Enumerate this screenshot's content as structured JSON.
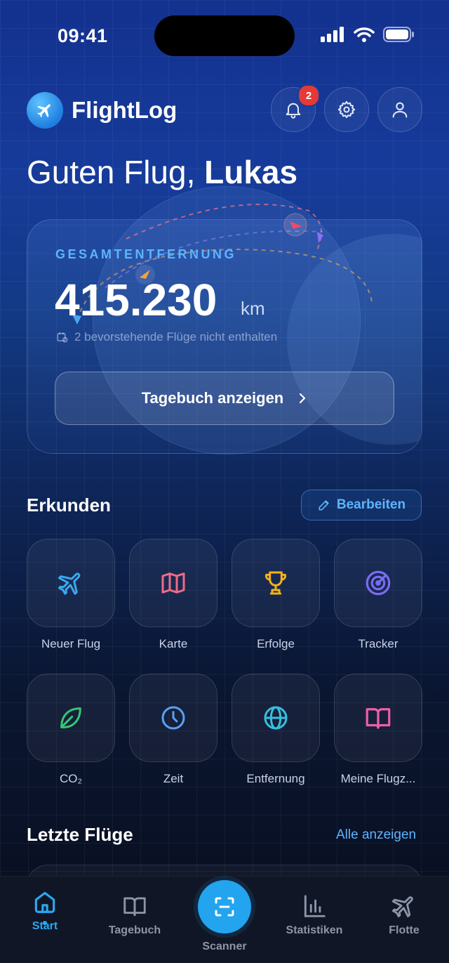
{
  "status_bar": {
    "time": "09:41"
  },
  "header": {
    "app_name": "FlightLog",
    "notifications_count": "2",
    "greeting_prefix": "Guten Flug,",
    "greeting_name": "Lukas"
  },
  "summary_card": {
    "label": "GESAMTENTFERNUNG",
    "value": "415.230",
    "unit": "km",
    "note": "2 bevorstehende Flüge nicht enthalten",
    "button_label": "Tagebuch anzeigen"
  },
  "explore": {
    "title": "Erkunden",
    "edit_label": "Bearbeiten",
    "tiles": [
      {
        "label": "Neuer Flug",
        "icon": "airplane-icon",
        "color": "#3aa8f0"
      },
      {
        "label": "Karte",
        "icon": "map-icon",
        "color": "#ef6b86"
      },
      {
        "label": "Erfolge",
        "icon": "trophy-icon",
        "color": "#f2b21c"
      },
      {
        "label": "Tracker",
        "icon": "radar-icon",
        "color": "#7b6cf5"
      },
      {
        "label": "CO₂",
        "icon": "leaf-icon",
        "color": "#34c776"
      },
      {
        "label": "Zeit",
        "icon": "clock-icon",
        "color": "#5aa0f5"
      },
      {
        "label": "Entfernung",
        "icon": "globe-icon",
        "color": "#36bfe0"
      },
      {
        "label": "Meine Flugz...",
        "icon": "book-icon",
        "color": "#ef5fa8"
      }
    ]
  },
  "recent": {
    "title": "Letzte Flüge",
    "link_label": "Alle anzeigen"
  },
  "tab_bar": {
    "tabs": [
      {
        "label": "Start",
        "icon": "home-icon",
        "active": true
      },
      {
        "label": "Tagebuch",
        "icon": "book-icon"
      },
      {
        "label": "Scanner",
        "icon": "scan-icon"
      },
      {
        "label": "Statistiken",
        "icon": "bar-chart-icon"
      },
      {
        "label": "Flotte",
        "icon": "airplane-icon"
      }
    ]
  },
  "colors": {
    "accent": "#5db4ff",
    "scanner": "#23a4ee",
    "badge": "#e53935"
  }
}
